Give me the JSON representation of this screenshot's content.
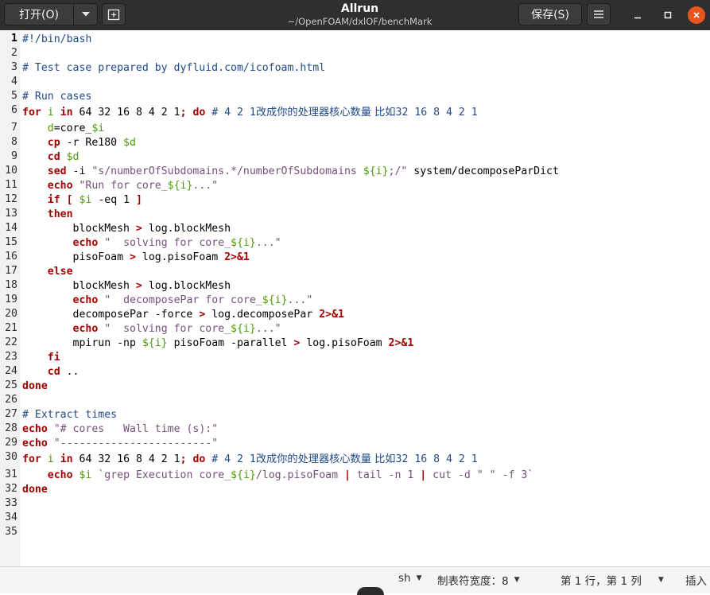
{
  "header": {
    "open_label": "打开(O)",
    "title": "Allrun",
    "subtitle": "~/OpenFOAM/dxlOF/benchMark",
    "save_label": "保存(S)"
  },
  "icons": {
    "open_dropdown": "chevron-down-icon",
    "new_tab": "new-tab-icon",
    "menu": "hamburger-menu-icon",
    "minimize": "minimize-icon",
    "maximize": "maximize-icon",
    "close": "close-icon"
  },
  "editor": {
    "current_line": 1,
    "colors": {
      "keyword": "#a40000",
      "comment": "#204a87",
      "string": "#75507b",
      "variable": "#4e9a06"
    },
    "lines": [
      {
        "n": "1",
        "t": [
          [
            "#!/bin/bash",
            "sb"
          ]
        ]
      },
      {
        "n": "2",
        "t": []
      },
      {
        "n": "3",
        "t": [
          [
            "# Test case prepared by dyfluid.com/icofoam.html",
            "cm"
          ]
        ]
      },
      {
        "n": "4",
        "t": []
      },
      {
        "n": "5",
        "t": [
          [
            "# Run cases",
            "cm"
          ]
        ]
      },
      {
        "n": "6",
        "tall": true,
        "t": [
          [
            "for",
            "kw"
          ],
          [
            " "
          ],
          [
            "i",
            "vr"
          ],
          [
            " "
          ],
          [
            "in",
            "kw"
          ],
          [
            " 64 32 16 8 4 2 1"
          ],
          [
            "; do",
            "kw"
          ],
          [
            " # 4 2 1",
            "cm"
          ],
          [
            "改成你的处理器核心数量 比如",
            "cm cjk"
          ],
          [
            "32 16 8 4 2 1",
            "cm"
          ]
        ]
      },
      {
        "n": "7",
        "t": [
          [
            "    "
          ],
          [
            "d",
            "vr"
          ],
          [
            "=core_"
          ],
          [
            "$i",
            "vr"
          ]
        ]
      },
      {
        "n": "8",
        "t": [
          [
            "    "
          ],
          [
            "cp",
            "kw"
          ],
          [
            " -r Re180 "
          ],
          [
            "$d",
            "vr"
          ]
        ]
      },
      {
        "n": "9",
        "t": [
          [
            "    "
          ],
          [
            "cd",
            "kw"
          ],
          [
            " "
          ],
          [
            "$d",
            "vr"
          ]
        ]
      },
      {
        "n": "10",
        "t": [
          [
            "    "
          ],
          [
            "sed",
            "kw"
          ],
          [
            " -i "
          ],
          [
            "\"s/numberOfSubdomains.*/numberOfSubdomains ",
            "st"
          ],
          [
            "${i}",
            "vr"
          ],
          [
            ";/\"",
            "st"
          ],
          [
            " system/decomposeParDict"
          ]
        ]
      },
      {
        "n": "11",
        "t": [
          [
            "    "
          ],
          [
            "echo",
            "kw"
          ],
          [
            " "
          ],
          [
            "\"Run for core_",
            "st"
          ],
          [
            "${i}",
            "vr"
          ],
          [
            "...\"",
            "st"
          ]
        ]
      },
      {
        "n": "12",
        "t": [
          [
            "    "
          ],
          [
            "if",
            "kw"
          ],
          [
            " "
          ],
          [
            "[",
            "kw"
          ],
          [
            " "
          ],
          [
            "$i",
            "vr"
          ],
          [
            " -eq 1 "
          ],
          [
            "]",
            "kw"
          ]
        ]
      },
      {
        "n": "13",
        "t": [
          [
            "    "
          ],
          [
            "then",
            "kw"
          ]
        ]
      },
      {
        "n": "14",
        "t": [
          [
            "        blockMesh "
          ],
          [
            ">",
            "kw"
          ],
          [
            " log.blockMesh"
          ]
        ]
      },
      {
        "n": "15",
        "t": [
          [
            "        "
          ],
          [
            "echo",
            "kw"
          ],
          [
            " "
          ],
          [
            "\"  solving for core_",
            "st"
          ],
          [
            "${i}",
            "vr"
          ],
          [
            "...\"",
            "st"
          ]
        ]
      },
      {
        "n": "16",
        "t": [
          [
            "        pisoFoam "
          ],
          [
            ">",
            "kw"
          ],
          [
            " log.pisoFoam "
          ],
          [
            "2>&1",
            "kw"
          ]
        ]
      },
      {
        "n": "17",
        "t": [
          [
            "    "
          ],
          [
            "else",
            "kw"
          ]
        ]
      },
      {
        "n": "18",
        "t": [
          [
            "        blockMesh "
          ],
          [
            ">",
            "kw"
          ],
          [
            " log.blockMesh"
          ]
        ]
      },
      {
        "n": "19",
        "t": [
          [
            "        "
          ],
          [
            "echo",
            "kw"
          ],
          [
            " "
          ],
          [
            "\"  decomposePar for core_",
            "st"
          ],
          [
            "${i}",
            "vr"
          ],
          [
            "...\"",
            "st"
          ]
        ]
      },
      {
        "n": "20",
        "t": [
          [
            "        decomposePar -force "
          ],
          [
            ">",
            "kw"
          ],
          [
            " log.decomposePar "
          ],
          [
            "2>&1",
            "kw"
          ]
        ]
      },
      {
        "n": "21",
        "t": [
          [
            "        "
          ],
          [
            "echo",
            "kw"
          ],
          [
            " "
          ],
          [
            "\"  solving for core_",
            "st"
          ],
          [
            "${i}",
            "vr"
          ],
          [
            "...\"",
            "st"
          ]
        ]
      },
      {
        "n": "22",
        "t": [
          [
            "        mpirun -np "
          ],
          [
            "${i}",
            "vr"
          ],
          [
            " pisoFoam -parallel "
          ],
          [
            ">",
            "kw"
          ],
          [
            " log.pisoFoam "
          ],
          [
            "2>&1",
            "kw"
          ]
        ]
      },
      {
        "n": "23",
        "t": [
          [
            "    "
          ],
          [
            "fi",
            "kw"
          ]
        ]
      },
      {
        "n": "24",
        "t": [
          [
            "    "
          ],
          [
            "cd",
            "kw"
          ],
          [
            " .."
          ]
        ]
      },
      {
        "n": "25",
        "t": [
          [
            "done",
            "kw"
          ]
        ]
      },
      {
        "n": "26",
        "t": []
      },
      {
        "n": "27",
        "t": [
          [
            "# Extract times",
            "cm"
          ]
        ]
      },
      {
        "n": "28",
        "t": [
          [
            "echo",
            "kw"
          ],
          [
            " "
          ],
          [
            "\"# cores   Wall time (s):\"",
            "st"
          ]
        ]
      },
      {
        "n": "29",
        "t": [
          [
            "echo",
            "kw"
          ],
          [
            " "
          ],
          [
            "\"------------------------\"",
            "st"
          ]
        ]
      },
      {
        "n": "30",
        "tall": true,
        "t": [
          [
            "for",
            "kw"
          ],
          [
            " "
          ],
          [
            "i",
            "vr"
          ],
          [
            " "
          ],
          [
            "in",
            "kw"
          ],
          [
            " 64 32 16 8 4 2 1"
          ],
          [
            "; do",
            "kw"
          ],
          [
            " # 4 2 1",
            "cm"
          ],
          [
            "改成你的处理器核心数量 比如",
            "cm cjk"
          ],
          [
            "32 16 8 4 2 1",
            "cm"
          ]
        ]
      },
      {
        "n": "31",
        "t": [
          [
            "    "
          ],
          [
            "echo",
            "kw"
          ],
          [
            " "
          ],
          [
            "$i",
            "vr"
          ],
          [
            " "
          ],
          [
            "`grep Execution core_",
            "st"
          ],
          [
            "${i}",
            "vr"
          ],
          [
            "/log.pisoFoam ",
            "st"
          ],
          [
            "|",
            "kw"
          ],
          [
            " tail -n 1 ",
            "st"
          ],
          [
            "|",
            "kw"
          ],
          [
            " cut -d \" \" -f 3`",
            "st"
          ]
        ]
      },
      {
        "n": "32",
        "t": [
          [
            "done",
            "kw"
          ]
        ]
      },
      {
        "n": "33",
        "t": []
      },
      {
        "n": "34",
        "t": []
      },
      {
        "n": "35",
        "t": []
      }
    ]
  },
  "statusbar": {
    "language": "sh",
    "tab_width": "制表符宽度：8",
    "position": "第 1 行，第 1 列",
    "insert_mode": "插入"
  }
}
